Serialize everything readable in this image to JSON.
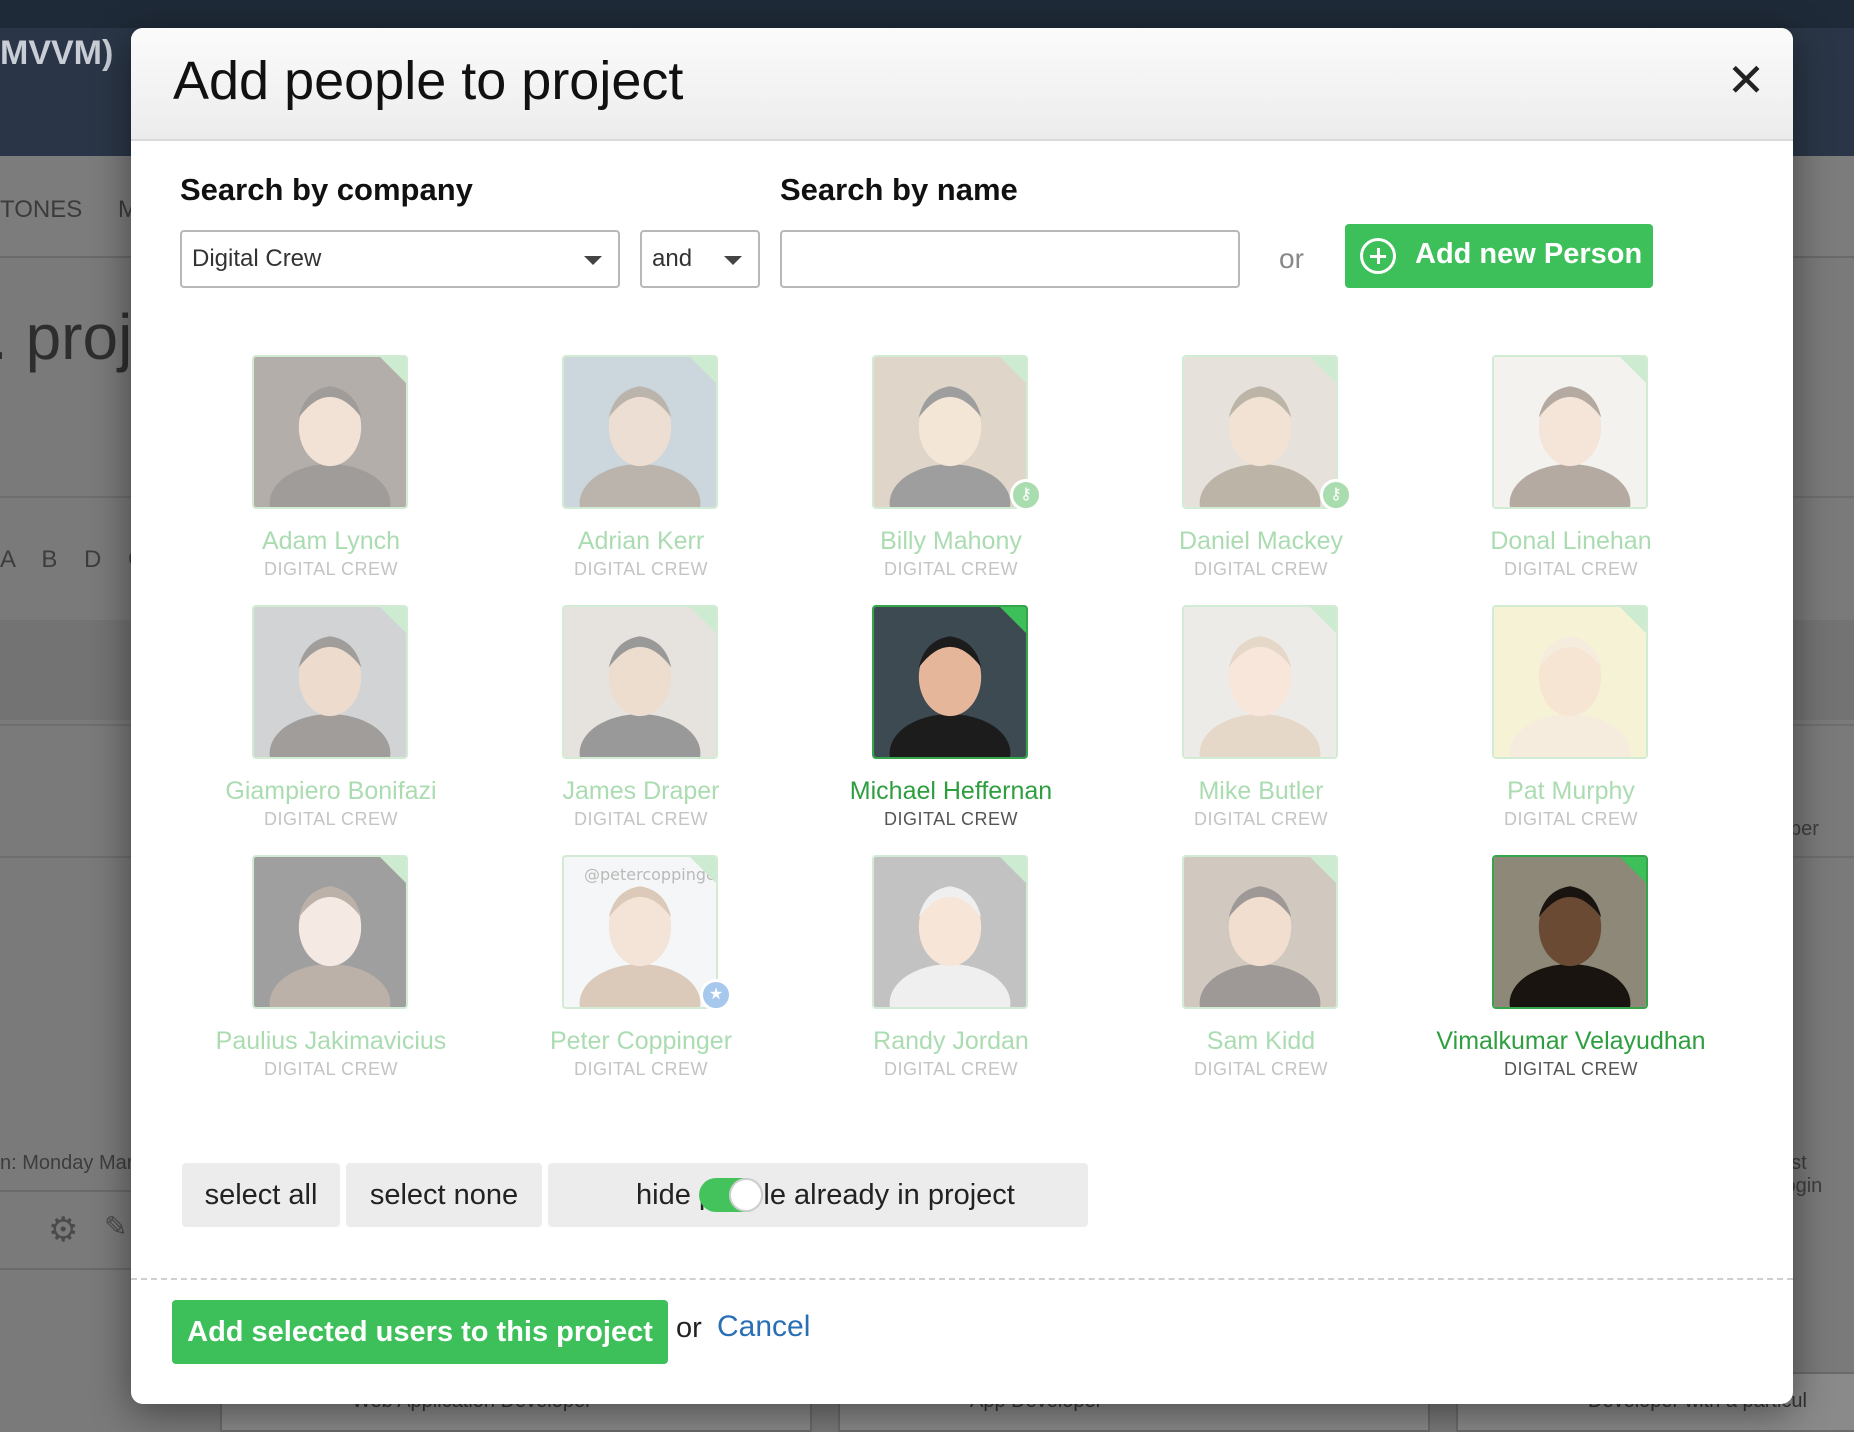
{
  "background": {
    "app_title": "MVVM)",
    "tabs": [
      "TONES",
      "M"
    ],
    "heading": ". proj",
    "letters": "A B D G J",
    "left_footer_text": "n: Monday Mar",
    "right_text_1": "per",
    "right_text_2": "ast login",
    "card_texts": [
      "Web Application Developer",
      "App Developer",
      "Developer with a particul"
    ]
  },
  "modal": {
    "title": "Add people to project",
    "close_icon": "close-icon"
  },
  "search": {
    "company_label": "Search by company",
    "company_value": "Digital Crew",
    "operator_value": "and",
    "name_label": "Search by name",
    "name_value": "",
    "or_text": "or",
    "add_person_label": "Add new Person",
    "add_person_icon": "plus-circle-icon"
  },
  "people": [
    {
      "name": "Adam Lynch",
      "company": "DIGITAL CREW",
      "selected": false,
      "badge": ""
    },
    {
      "name": "Adrian Kerr",
      "company": "DIGITAL CREW",
      "selected": false,
      "badge": ""
    },
    {
      "name": "Billy Mahony",
      "company": "DIGITAL CREW",
      "selected": false,
      "badge": "key"
    },
    {
      "name": "Daniel Mackey",
      "company": "DIGITAL CREW",
      "selected": false,
      "badge": "key"
    },
    {
      "name": "Donal Linehan",
      "company": "DIGITAL CREW",
      "selected": false,
      "badge": ""
    },
    {
      "name": "Giampiero Bonifazi",
      "company": "DIGITAL CREW",
      "selected": false,
      "badge": ""
    },
    {
      "name": "James Draper",
      "company": "DIGITAL CREW",
      "selected": false,
      "badge": ""
    },
    {
      "name": "Michael Heffernan",
      "company": "DIGITAL CREW",
      "selected": true,
      "badge": ""
    },
    {
      "name": "Mike Butler",
      "company": "DIGITAL CREW",
      "selected": false,
      "badge": ""
    },
    {
      "name": "Pat Murphy",
      "company": "DIGITAL CREW",
      "selected": false,
      "badge": ""
    },
    {
      "name": "Paulius Jakimavicius",
      "company": "DIGITAL CREW",
      "selected": false,
      "badge": ""
    },
    {
      "name": "Peter Coppinger",
      "company": "DIGITAL CREW",
      "selected": false,
      "badge": "star",
      "avatar_text": "@petercoppinger"
    },
    {
      "name": "Randy Jordan",
      "company": "DIGITAL CREW",
      "selected": false,
      "badge": ""
    },
    {
      "name": "Sam Kidd",
      "company": "DIGITAL CREW",
      "selected": false,
      "badge": ""
    },
    {
      "name": "Vimalkumar Velayudhan",
      "company": "DIGITAL CREW",
      "selected": true,
      "badge": ""
    }
  ],
  "controls": {
    "select_all": "select all",
    "select_none": "select none",
    "hide_toggle_label": "hide people already in project",
    "hide_toggle_on": true
  },
  "footer": {
    "submit_label": "Add selected users to this project",
    "or_text": "or",
    "cancel_label": "Cancel"
  },
  "colors": {
    "accent_green": "#3dbf5a",
    "link_blue": "#2a6fb5",
    "header_navy": "#2a3647"
  }
}
